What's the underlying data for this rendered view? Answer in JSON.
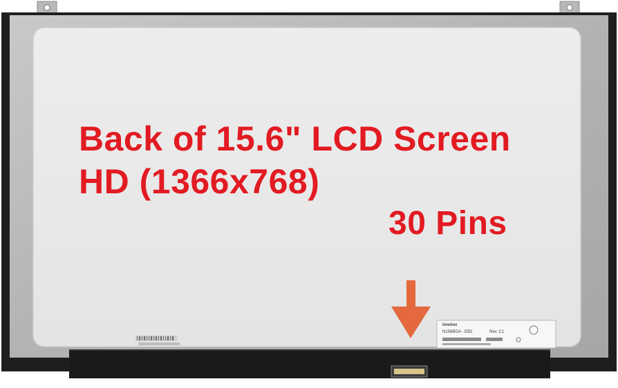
{
  "overlay": {
    "line1": "Back of 15.6\" LCD Screen",
    "line2": "HD (1366x768)",
    "line3": "30 Pins"
  },
  "sticker": {
    "brand": "Innolux",
    "model": "N156BGA - EB2",
    "rev": "Rev. C1"
  },
  "colors": {
    "text_accent": "#e21b22",
    "arrow": "#e4693f",
    "panel_back": "#e9e9e9",
    "bezel": "#1e1e1e"
  }
}
